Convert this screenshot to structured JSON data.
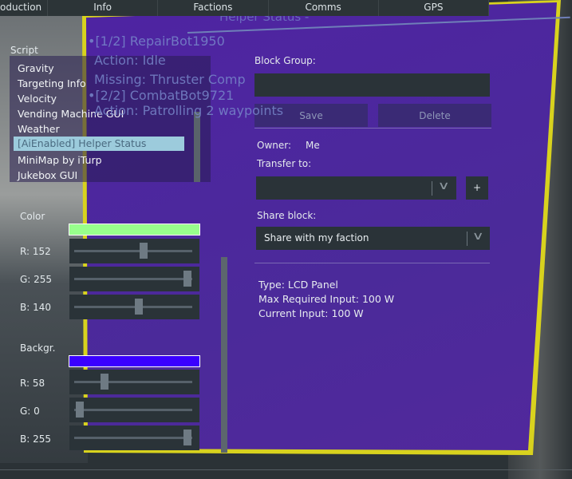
{
  "tabs": [
    "oduction",
    "Info",
    "Factions",
    "Comms",
    "GPS"
  ],
  "lcd": {
    "title": "Helper Status -",
    "lines": [
      "•[1/2] RepairBot1950",
      "Action: Idle",
      "Missing: Thruster Comp",
      "•[2/2] CombatBot9721",
      "Action: Patrolling 2 waypoints"
    ],
    "background_color": "#3a00ff",
    "font_color": "#98ff8c"
  },
  "script": {
    "label": "Script",
    "items": [
      "Gravity",
      "Targeting Info",
      "Velocity",
      "Vending Machine GUI",
      "Weather",
      "[AiEnabled] Helper Status",
      "MiniMap by iTurp",
      "Jukebox GUI"
    ],
    "selected": 5
  },
  "color": {
    "label": "Color",
    "r_label": "R: 152",
    "g_label": "G: 255",
    "b_label": "B: 140",
    "r": 152,
    "g": 255,
    "b": 140,
    "swatch": "#98ff8c"
  },
  "backgr": {
    "label": "Backgr.",
    "r_label": "R: 58",
    "g_label": "G: 0",
    "b_label": "B: 255",
    "r": 58,
    "g": 0,
    "b": 255,
    "swatch": "#3a00ff"
  },
  "props": {
    "block_group_label": "Block Group:",
    "block_group_value": "",
    "save": "Save",
    "delete": "Delete",
    "owner_label": "Owner:",
    "owner_value": "Me",
    "transfer_label": "Transfer to:",
    "transfer_value": "",
    "add": "+",
    "share_label": "Share block:",
    "share_value": "Share with my faction",
    "type": "Type: LCD Panel",
    "max_input": "Max Required Input: 100 W",
    "current_input": "Current Input: 100 W"
  }
}
